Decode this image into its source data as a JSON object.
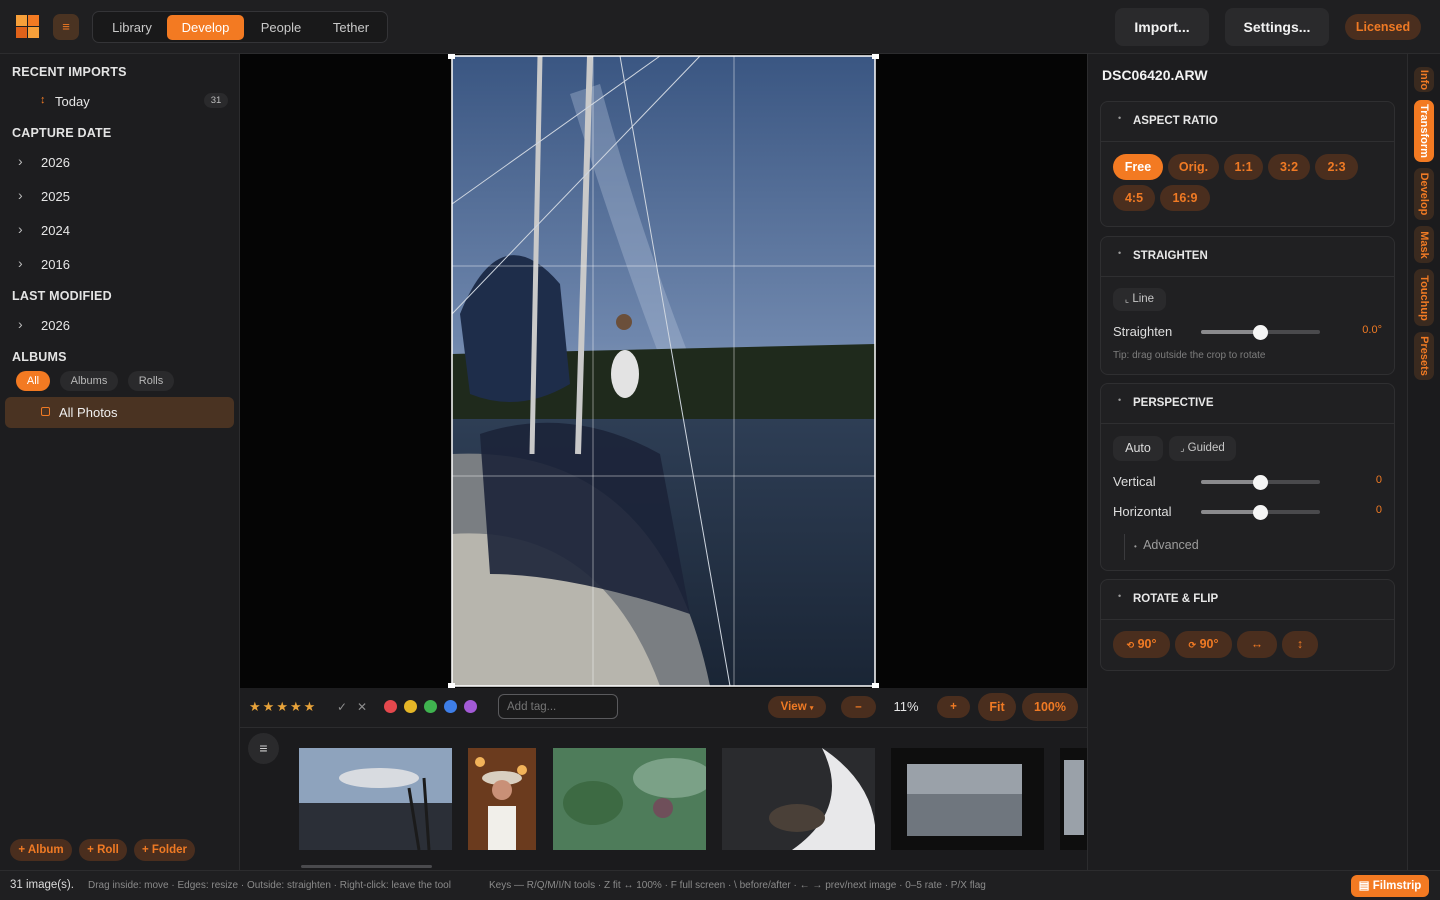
{
  "topbar": {
    "tabs": [
      "Library",
      "Develop",
      "People",
      "Tether"
    ],
    "active_tab": "Develop",
    "import_label": "Import...",
    "settings_label": "Settings...",
    "license_label": "Licensed",
    "menu_glyph": "≡"
  },
  "sidebar": {
    "recent_imports": {
      "title": "RECENT IMPORTS",
      "items": [
        {
          "label": "Today",
          "count": "31"
        }
      ]
    },
    "capture_date": {
      "title": "CAPTURE DATE",
      "years": [
        "2026",
        "2025",
        "2024",
        "2016"
      ]
    },
    "last_modified": {
      "title": "LAST MODIFIED",
      "years": [
        "2026"
      ]
    },
    "albums": {
      "title": "ALBUMS",
      "filters": [
        "All",
        "Albums",
        "Rolls"
      ],
      "active_filter": "All",
      "items": [
        {
          "label": "All Photos",
          "selected": true
        }
      ]
    },
    "footer_buttons": [
      "+ Album",
      "+ Roll",
      "+ Folder"
    ]
  },
  "toolstrip": {
    "stars": [
      "★",
      "★",
      "★",
      "★",
      "★"
    ],
    "flag_glyphs": [
      "✓",
      "✕"
    ],
    "color_labels": [
      "#e5484d",
      "#e5b627",
      "#3fb34f",
      "#3e7ee8",
      "#a35ad6"
    ],
    "tag_placeholder": "Add tag...",
    "view_label": "View",
    "zoom_out": "–",
    "zoom_level": "11%",
    "zoom_in": "+",
    "fit_label": "Fit",
    "full_label": "100%"
  },
  "right": {
    "filename": "DSC06420.ARW",
    "aspect_ratio": {
      "title": "ASPECT RATIO",
      "options": [
        "Free",
        "Orig.",
        "1:1",
        "3:2",
        "2:3",
        "4:5",
        "16:9"
      ],
      "active": "Free"
    },
    "straighten": {
      "title": "STRAIGHTEN",
      "line_label": "Line",
      "slider_label": "Straighten",
      "value": "0.0°",
      "tip": "Tip: drag outside the crop to rotate"
    },
    "perspective": {
      "title": "PERSPECTIVE",
      "auto_label": "Auto",
      "guided_label": "Guided",
      "vertical_label": "Vertical",
      "vertical_value": "0",
      "horizontal_label": "Horizontal",
      "horizontal_value": "0",
      "advanced_label": "Advanced"
    },
    "rotate_flip": {
      "title": "ROTATE & FLIP",
      "rotate_ccw": "90°",
      "rotate_cw": "90°",
      "flip_h": "↔",
      "flip_v": "↕"
    }
  },
  "vtabs": [
    "Info",
    "Transform",
    "Develop",
    "Mask",
    "Touchup",
    "Presets"
  ],
  "vtab_active": "Transform",
  "status": {
    "count": "31 image(s).",
    "hint": "Drag inside: move · Edges: resize · Outside: straighten · Right-click: leave the tool",
    "keys": "Keys — R/Q/M/I/N tools · Z fit ↔ 100% · F full screen · \\ before/after · ← → prev/next image · 0–5 rate · P/X flag",
    "filmstrip_label": "Filmstrip"
  },
  "colors": {
    "accent": "#f37a22",
    "accent_dim": "#4a2e1e",
    "bg": "#1b1b1d"
  }
}
